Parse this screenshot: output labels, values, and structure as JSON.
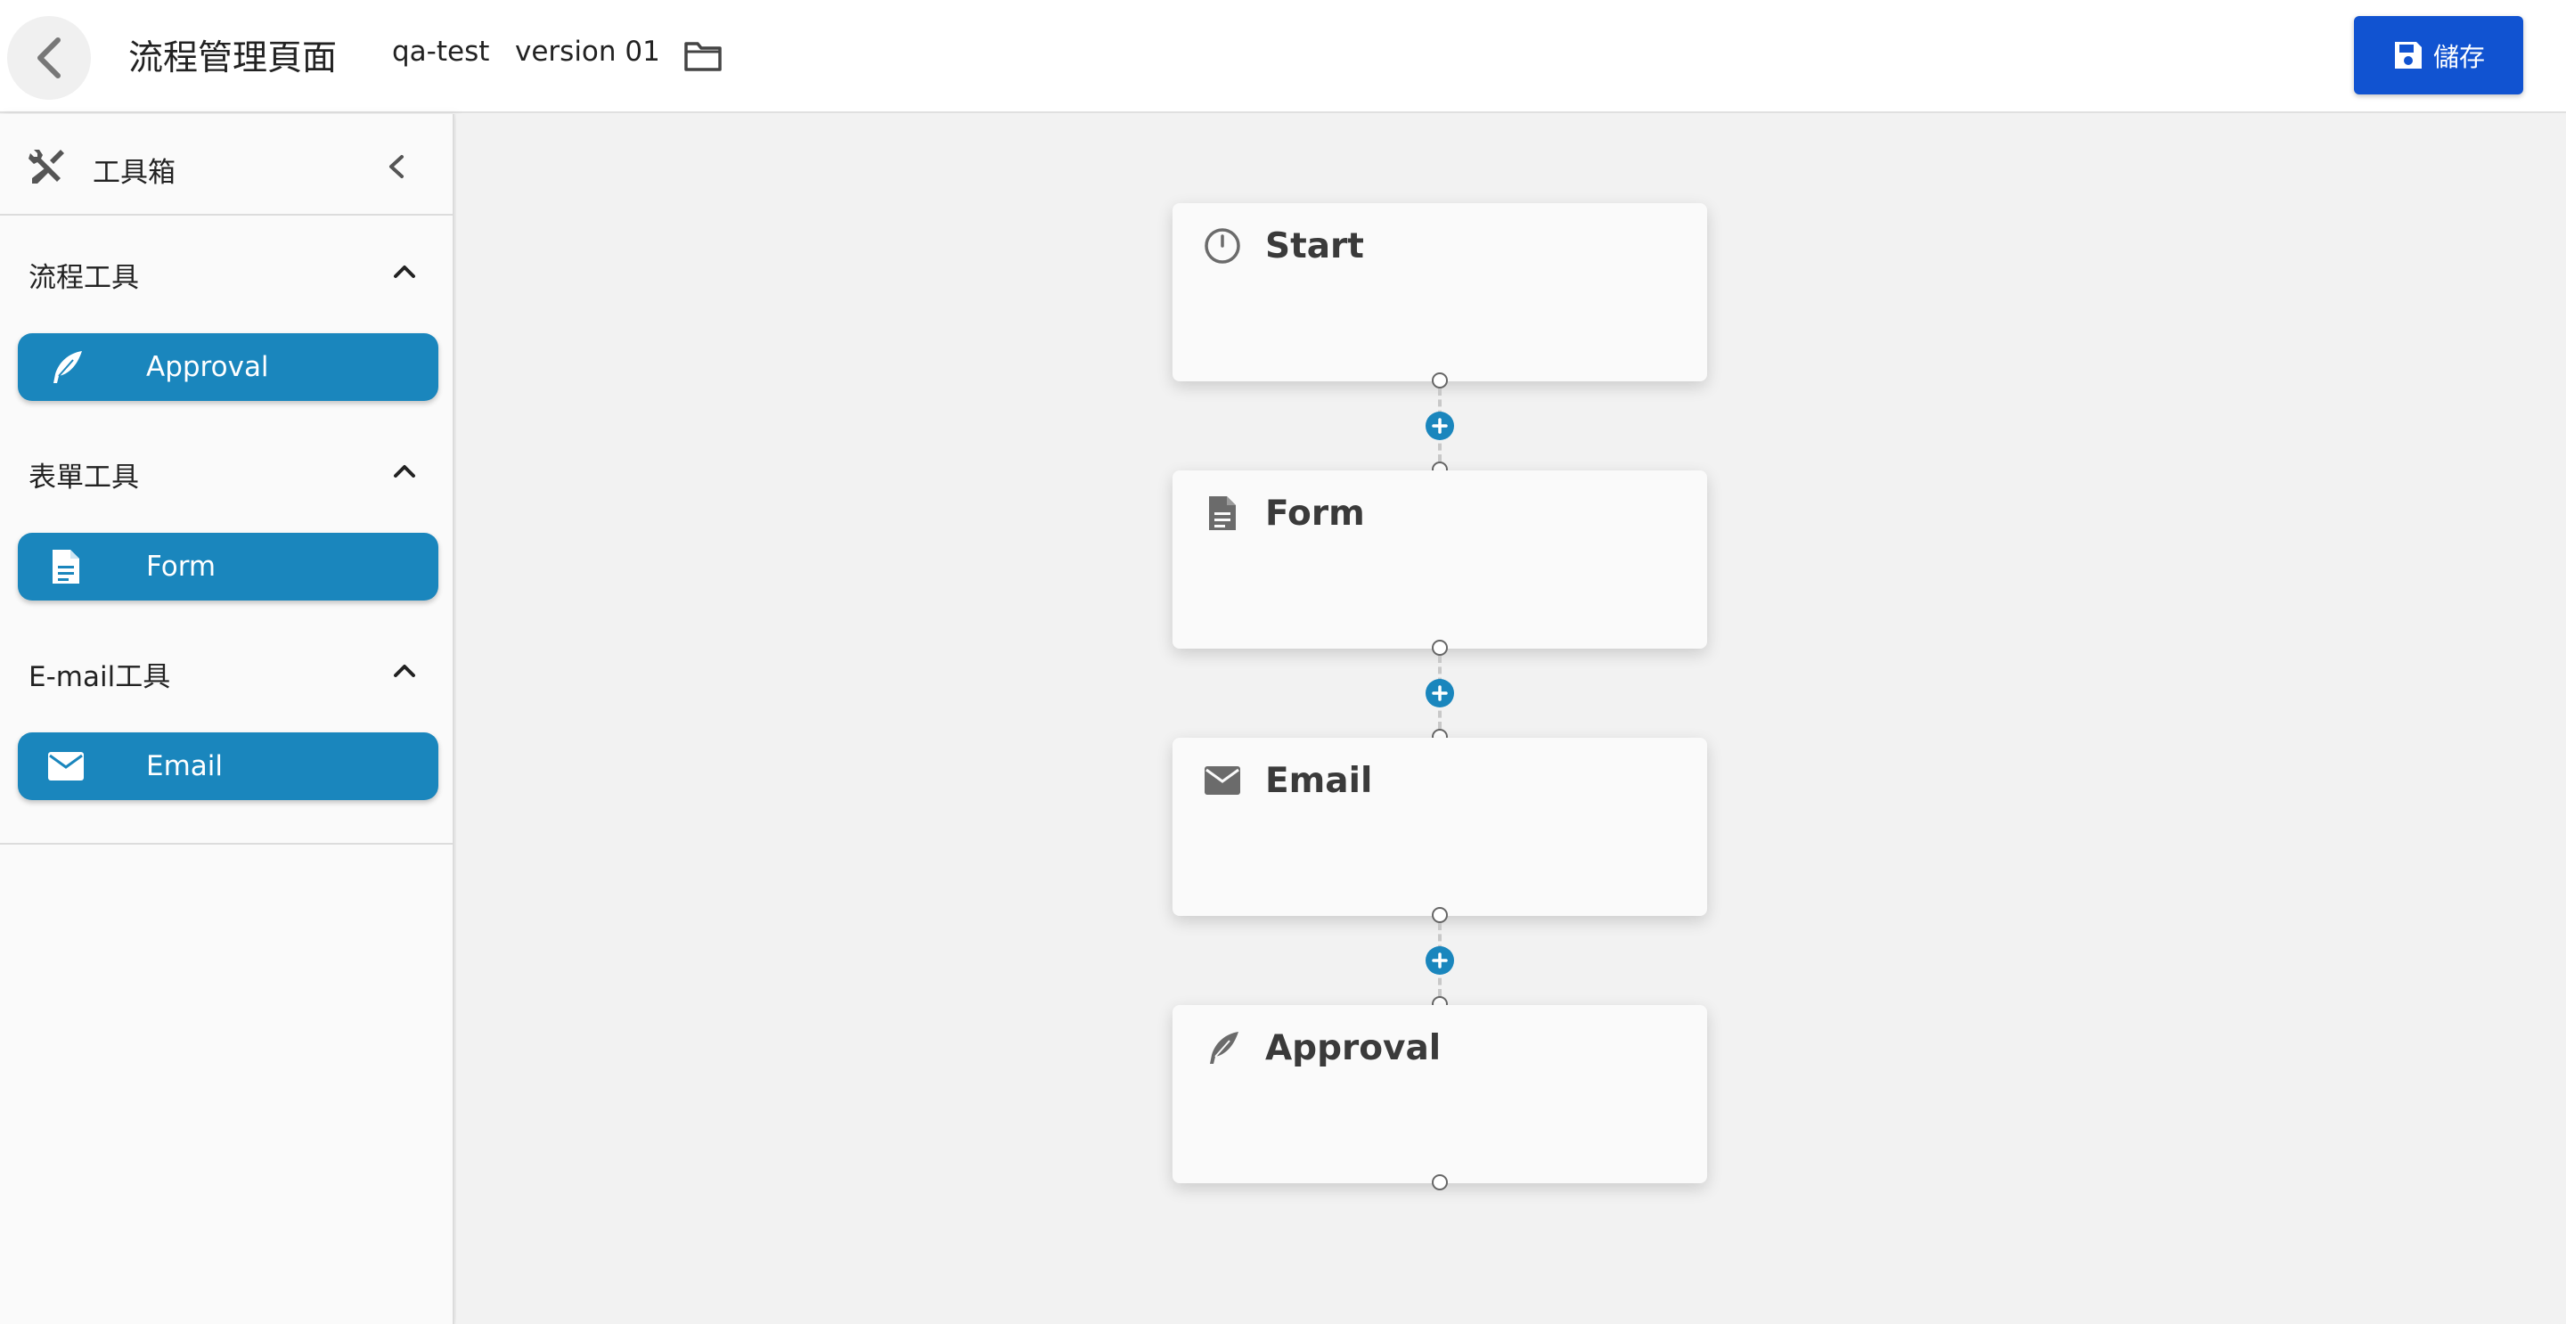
{
  "header": {
    "back_icon": "chevron-left-icon",
    "title": "流程管理頁面",
    "project": "qa-test",
    "version": "version 01",
    "folder_icon": "folder-outline-icon",
    "save_label": "儲存",
    "save_icon": "floppy-disk-icon"
  },
  "toolbox": {
    "title": "工具箱",
    "icon": "wrench-screwdriver-icon",
    "collapse_icon": "chevron-left-icon",
    "sections": [
      {
        "label": "流程工具",
        "tools": [
          {
            "label": "Approval",
            "icon": "feather-icon"
          }
        ]
      },
      {
        "label": "表單工具",
        "tools": [
          {
            "label": "Form",
            "icon": "document-icon"
          }
        ]
      },
      {
        "label": "E-mail工具",
        "tools": [
          {
            "label": "Email",
            "icon": "envelope-icon"
          }
        ]
      }
    ]
  },
  "flow": {
    "nodes": [
      {
        "label": "Start",
        "icon": "clock-icon"
      },
      {
        "label": "Form",
        "icon": "document-icon"
      },
      {
        "label": "Email",
        "icon": "envelope-icon"
      },
      {
        "label": "Approval",
        "icon": "feather-icon"
      }
    ]
  },
  "colors": {
    "primary_button": "#1153d1",
    "tool_button": "#1a86bd",
    "add_button": "#1a86bd",
    "canvas_bg": "#f2f2f2"
  }
}
